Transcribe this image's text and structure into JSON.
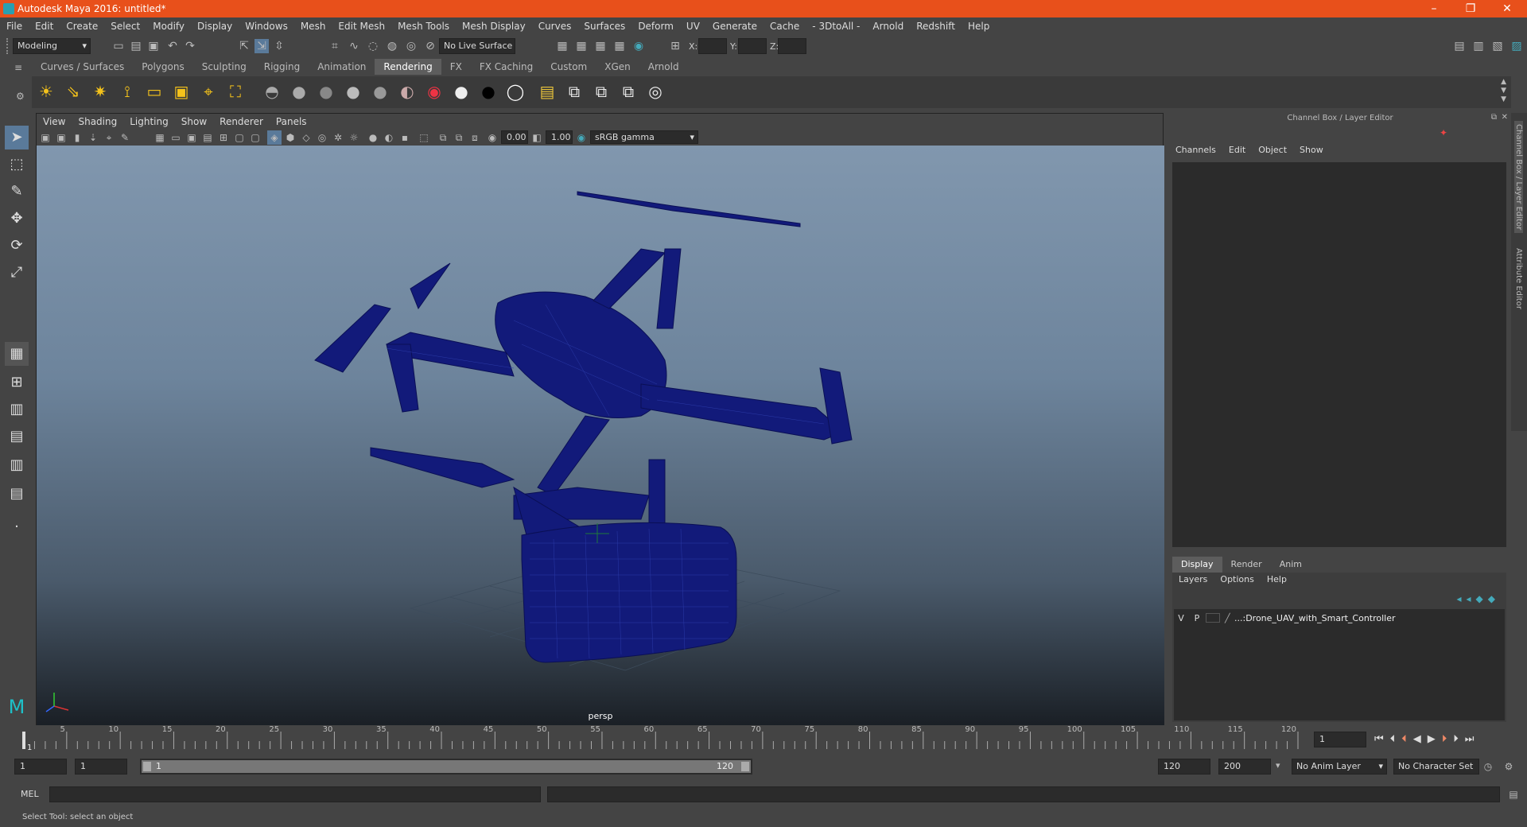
{
  "window": {
    "title": "Autodesk Maya 2016: untitled*"
  },
  "menu": [
    "File",
    "Edit",
    "Create",
    "Select",
    "Modify",
    "Display",
    "Windows",
    "Mesh",
    "Edit Mesh",
    "Mesh Tools",
    "Mesh Display",
    "Curves",
    "Surfaces",
    "Deform",
    "UV",
    "Generate",
    "Cache",
    "- 3DtoAll -",
    "Arnold",
    "Redshift",
    "Help"
  ],
  "status": {
    "mode": "Modeling",
    "live_surface": "No Live Surface",
    "x_label": "X:",
    "y_label": "Y:",
    "z_label": "Z:"
  },
  "shelf_tabs": [
    "Curves / Surfaces",
    "Polygons",
    "Sculpting",
    "Rigging",
    "Animation",
    "Rendering",
    "FX",
    "FX Caching",
    "Custom",
    "XGen",
    "Arnold"
  ],
  "shelf_active": "Rendering",
  "viewport": {
    "menu": [
      "View",
      "Shading",
      "Lighting",
      "Show",
      "Renderer",
      "Panels"
    ],
    "exposure": "0.00",
    "gamma": "1.00",
    "color_space": "sRGB gamma",
    "camera": "persp"
  },
  "channel_box": {
    "title": "Channel Box / Layer Editor",
    "menu": [
      "Channels",
      "Edit",
      "Object",
      "Show"
    ],
    "side_tabs": [
      "Channel Box / Layer Editor",
      "Attribute Editor"
    ]
  },
  "layers": {
    "tabs": [
      "Display",
      "Render",
      "Anim"
    ],
    "menu": [
      "Layers",
      "Options",
      "Help"
    ],
    "row": {
      "v": "V",
      "p": "P",
      "name": "...:Drone_UAV_with_Smart_Controller"
    }
  },
  "timeline": {
    "ticks": [
      "5",
      "10",
      "15",
      "20",
      "25",
      "30",
      "35",
      "40",
      "45",
      "50",
      "55",
      "60",
      "65",
      "70",
      "75",
      "80",
      "85",
      "90",
      "95",
      "100",
      "105",
      "110",
      "115",
      "120"
    ],
    "start_marker": "1",
    "current_frame": "1"
  },
  "range": {
    "start": "1",
    "playback_start": "1",
    "slider_start": "1",
    "slider_end": "120",
    "playback_end": "120",
    "end": "200",
    "anim_layer": "No Anim Layer",
    "char_set": "No Character Set"
  },
  "command": {
    "label": "MEL"
  },
  "help": {
    "text": "Select Tool: select an object"
  }
}
